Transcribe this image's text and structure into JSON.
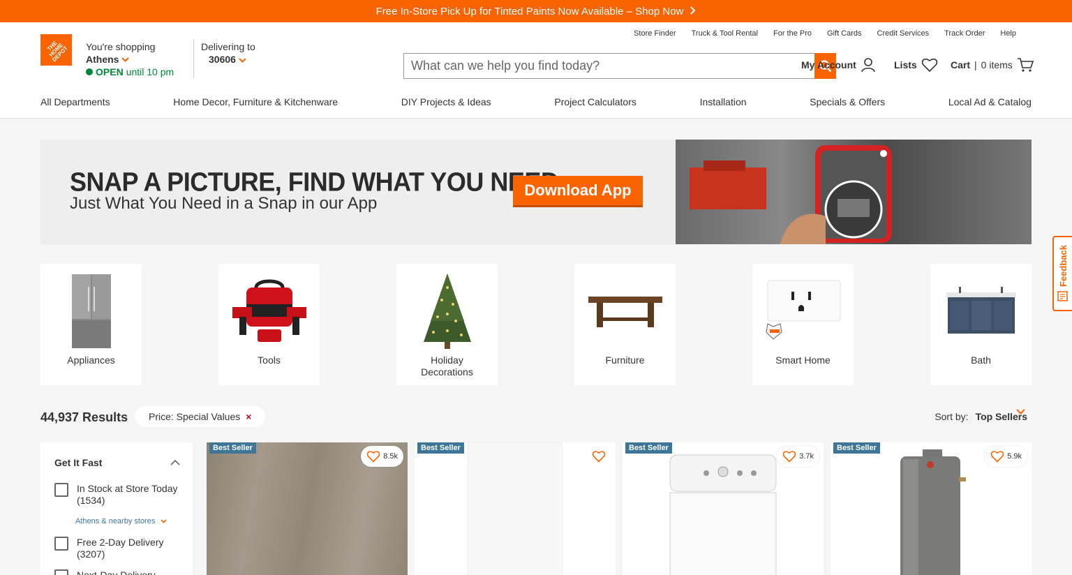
{
  "promo": {
    "text": "Free In-Store Pick Up for Tinted Paints Now Available – Shop Now"
  },
  "brand": {
    "logo_text": "THE HOME DEPOT",
    "accent": "#f96302"
  },
  "store": {
    "prefix": "You're shopping",
    "name": "Athens",
    "status": "OPEN",
    "hours": "until 10 pm"
  },
  "delivery": {
    "label": "Delivering to",
    "zip": "30606"
  },
  "utility_links": [
    "Store Finder",
    "Truck & Tool Rental",
    "For the Pro",
    "Gift Cards",
    "Credit Services",
    "Track Order",
    "Help"
  ],
  "search": {
    "placeholder": "What can we help you find today?"
  },
  "account": {
    "my_account": "My Account",
    "lists": "Lists",
    "cart": "Cart",
    "cart_sep": "|",
    "cart_count": "0 items"
  },
  "nav": [
    "All Departments",
    "Home Decor, Furniture & Kitchenware",
    "DIY Projects & Ideas",
    "Project Calculators",
    "Installation",
    "Specials & Offers",
    "Local Ad & Catalog"
  ],
  "hero": {
    "title": "SNAP A PICTURE, FIND WHAT YOU NEED",
    "subtitle": "Just What You Need in a Snap in our App",
    "cta": "Download App"
  },
  "categories": [
    {
      "label": "Appliances",
      "icon": "refrigerator-image"
    },
    {
      "label": "Tools",
      "icon": "drill-kit-image"
    },
    {
      "label": "Holiday Decorations",
      "icon": "christmas-tree-image"
    },
    {
      "label": "Furniture",
      "icon": "table-image"
    },
    {
      "label": "Smart Home",
      "icon": "smart-outlet-image"
    },
    {
      "label": "Bath",
      "icon": "vanity-image"
    }
  ],
  "results": {
    "count": "44,937 Results",
    "filter_chip": "Price: Special Values",
    "remove": "×",
    "sort_label": "Sort by:",
    "sort_value": "Top Sellers"
  },
  "facets": {
    "title": "Get It Fast",
    "options": [
      {
        "label": "In Stock at Store Today",
        "count": "(1534)"
      },
      {
        "label": "Free 2-Day Delivery",
        "count": "(3207)"
      },
      {
        "label": "Next-Day Delivery",
        "count": ""
      }
    ],
    "nearby": "Athens & nearby stores"
  },
  "products": [
    {
      "badge": "Best Seller",
      "favorites": "8.5k"
    },
    {
      "badge": "Best Seller",
      "favorites": ""
    },
    {
      "badge": "Best Seller",
      "favorites": "3.7k"
    },
    {
      "badge": "Best Seller",
      "favorites": "5.9k"
    }
  ],
  "feedback": {
    "label": "Feedback"
  }
}
